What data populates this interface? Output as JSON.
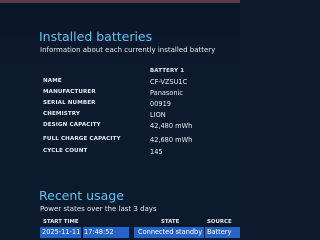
{
  "installed_batteries": {
    "title": "Installed batteries",
    "subtitle": "Information about each currently installed battery",
    "battery_header": "BATTERY 1",
    "rows": [
      {
        "label": "NAME",
        "value": "CF-VZSU1C"
      },
      {
        "label": "MANUFACTURER",
        "value": "Panasonic"
      },
      {
        "label": "SERIAL NUMBER",
        "value": "00919"
      },
      {
        "label": "CHEMISTRY",
        "value": "LION"
      },
      {
        "label": "DESIGN CAPACITY",
        "value": "42,480 mWh"
      },
      {
        "label": "FULL CHARGE CAPACITY",
        "value": "42,680 mWh"
      },
      {
        "label": "CYCLE COUNT",
        "value": "145"
      }
    ]
  },
  "recent_usage": {
    "title": "Recent usage",
    "subtitle": "Power states over the last 3 days",
    "columns": {
      "start_time": "START TIME",
      "state": "STATE",
      "source": "SOURCE"
    },
    "row": {
      "date": "2025-11-11",
      "time": "17:48:52",
      "state": "Connected standby",
      "source": "Battery"
    }
  },
  "colors": {
    "accent": "#62c3f0",
    "background": "#0d1b2f",
    "highlight_row": "#2563c9"
  }
}
